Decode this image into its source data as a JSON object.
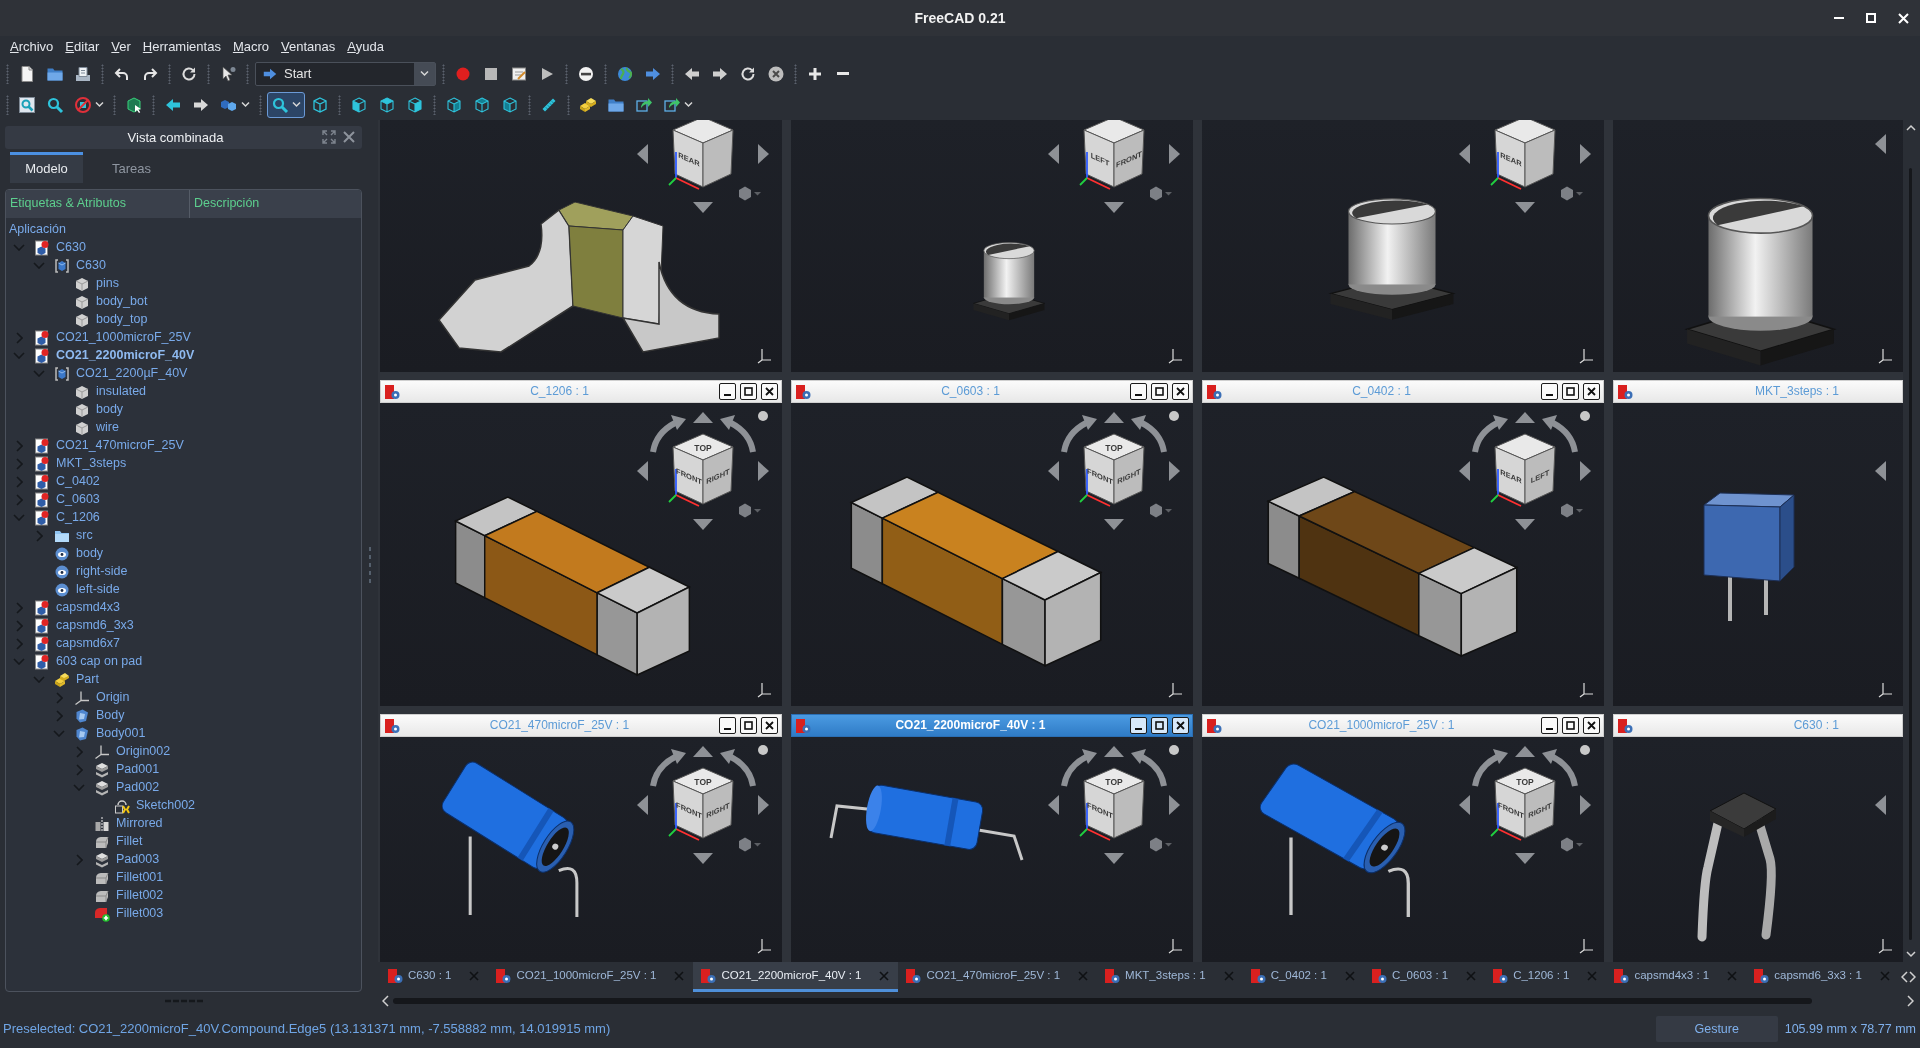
{
  "window": {
    "title": "FreeCAD 0.21"
  },
  "menu": [
    "Archivo",
    "Editar",
    "Ver",
    "Herramientas",
    "Macro",
    "Ventanas",
    "Ayuda"
  ],
  "workbench": {
    "value": "Start"
  },
  "view_toolbar": [
    {
      "pressed": false
    },
    {
      "pressed": false
    },
    {
      "pressed": false
    },
    {
      "pressed": false
    },
    {
      "pressed": false
    },
    {
      "pressed": false
    },
    {
      "pressed": false
    },
    {
      "pressed": true
    },
    {
      "pressed": false
    },
    {
      "pressed": false
    },
    {
      "pressed": false
    },
    {
      "pressed": false
    },
    {
      "pressed": false
    },
    {
      "pressed": false
    },
    {
      "pressed": false
    },
    {
      "pressed": false
    },
    {
      "pressed": false
    },
    {
      "pressed": false
    },
    {
      "pressed": false
    },
    {
      "pressed": false
    }
  ],
  "combo_view": {
    "title": "Vista combinada",
    "tabs": [
      {
        "label": "Modelo",
        "selected": true
      },
      {
        "label": "Tareas",
        "selected": false
      }
    ],
    "columns": [
      "Etiquetas & Atributos",
      "Descripción"
    ],
    "root": "Aplicación",
    "tree": [
      {
        "label": "C630",
        "kind": "document",
        "active": false,
        "expanded": true,
        "children": [
          {
            "label": "C630",
            "kind": "compound",
            "expanded": true,
            "children": [
              {
                "label": "pins",
                "kind": "solid"
              },
              {
                "label": "body_bot",
                "kind": "solid"
              },
              {
                "label": "body_top",
                "kind": "solid"
              }
            ]
          }
        ]
      },
      {
        "label": "CO21_1000microF_25V",
        "kind": "document",
        "active": false,
        "expanded": false
      },
      {
        "label": "CO21_2200microF_40V",
        "kind": "document",
        "active": true,
        "expanded": true,
        "children": [
          {
            "label": "CO21_2200µF_40V",
            "kind": "compound",
            "expanded": true,
            "children": [
              {
                "label": "insulated",
                "kind": "solid"
              },
              {
                "label": "body",
                "kind": "solid"
              },
              {
                "label": "wire",
                "kind": "solid"
              }
            ]
          }
        ]
      },
      {
        "label": "CO21_470microF_25V",
        "kind": "document",
        "active": false,
        "expanded": false
      },
      {
        "label": "MKT_3steps",
        "kind": "document",
        "active": false,
        "expanded": false
      },
      {
        "label": "C_0402",
        "kind": "document",
        "active": false,
        "expanded": false
      },
      {
        "label": "C_0603",
        "kind": "document",
        "active": false,
        "expanded": false
      },
      {
        "label": "C_1206",
        "kind": "document",
        "active": false,
        "expanded": true,
        "children": [
          {
            "label": "src",
            "kind": "folder",
            "expanded": false
          },
          {
            "label": "body",
            "kind": "feature"
          },
          {
            "label": "right-side",
            "kind": "feature"
          },
          {
            "label": "left-side",
            "kind": "feature"
          }
        ]
      },
      {
        "label": "capsmd4x3",
        "kind": "document",
        "active": false,
        "expanded": false
      },
      {
        "label": "capsmd6_3x3",
        "kind": "document",
        "active": false,
        "expanded": false
      },
      {
        "label": "capsmd6x7",
        "kind": "document",
        "active": false,
        "expanded": false
      },
      {
        "label": "603 cap on pad",
        "kind": "document",
        "active": false,
        "expanded": true,
        "children": [
          {
            "label": "Part",
            "kind": "part",
            "expanded": true,
            "children": [
              {
                "label": "Origin",
                "kind": "origin",
                "expanded": false
              },
              {
                "label": "Body",
                "kind": "body",
                "expanded": false
              },
              {
                "label": "Body001",
                "kind": "body",
                "expanded": true,
                "children": [
                  {
                    "label": "Origin002",
                    "kind": "origin",
                    "expanded": false
                  },
                  {
                    "label": "Pad001",
                    "kind": "pad",
                    "expanded": false
                  },
                  {
                    "label": "Pad002",
                    "kind": "pad",
                    "expanded": true,
                    "children": [
                      {
                        "label": "Sketch002",
                        "kind": "sketch"
                      }
                    ]
                  },
                  {
                    "label": "Mirrored",
                    "kind": "mirrored"
                  },
                  {
                    "label": "Fillet",
                    "kind": "fillet"
                  },
                  {
                    "label": "Pad003",
                    "kind": "pad",
                    "expanded": false
                  },
                  {
                    "label": "Fillet001",
                    "kind": "fillet"
                  },
                  {
                    "label": "Fillet002",
                    "kind": "fillet"
                  },
                  {
                    "label": "Fillet003",
                    "kind": "tip"
                  }
                ]
              }
            ]
          }
        ]
      }
    ]
  },
  "viewer": {
    "windows": [
      {
        "kind": "pads-chip",
        "cube_faces": [
          {
            "label": "REAR",
            "kind": "left"
          }
        ]
      },
      {
        "kind": "smd-electrolytic",
        "cube_faces": [
          {
            "label": "LEFT",
            "kind": "left"
          },
          {
            "label": "FRONT",
            "kind": "right"
          }
        ]
      },
      {
        "kind": "smd-electrolytic",
        "cube_faces": [
          {
            "label": "REAR",
            "kind": "left"
          }
        ]
      },
      {
        "kind": "smd-electrolytic"
      },
      {
        "title": "C_1206 : 1",
        "active": false,
        "kind": "chip",
        "color": "#c27a1e",
        "cube_faces": [
          {
            "label": "TOP",
            "kind": "top"
          },
          {
            "label": "FRONT",
            "kind": "left"
          },
          {
            "label": "RIGHT",
            "kind": "right"
          }
        ]
      },
      {
        "title": "C_0603 : 1",
        "active": false,
        "kind": "chip",
        "color": "#c9821f",
        "cube_faces": [
          {
            "label": "TOP",
            "kind": "top"
          },
          {
            "label": "FRONT",
            "kind": "left"
          },
          {
            "label": "RIGHT",
            "kind": "right"
          }
        ]
      },
      {
        "title": "C_0402 : 1",
        "active": false,
        "kind": "chip",
        "color": "#6e4718",
        "cube_faces": [
          {
            "label": "REAR",
            "kind": "left"
          },
          {
            "label": "LEFT",
            "kind": "right"
          }
        ]
      },
      {
        "title": "MKT_3steps : 1",
        "active": false,
        "kind": "box"
      },
      {
        "title": "CO21_470microF_25V : 1",
        "active": false,
        "kind": "axial-tilted",
        "cube_faces": [
          {
            "label": "TOP",
            "kind": "top"
          },
          {
            "label": "FRONT",
            "kind": "left"
          },
          {
            "label": "RIGHT",
            "kind": "right"
          }
        ]
      },
      {
        "title": "CO21_2200microF_40V : 1",
        "active": true,
        "kind": "axial",
        "cube_faces": [
          {
            "label": "TOP",
            "kind": "top"
          },
          {
            "label": "FRONT",
            "kind": "left"
          }
        ]
      },
      {
        "title": "CO21_1000microF_25V : 1",
        "active": false,
        "kind": "axial-tilted",
        "cube_faces": [
          {
            "label": "TOP",
            "kind": "top"
          },
          {
            "label": "FRONT",
            "kind": "left"
          },
          {
            "label": "RIGHT",
            "kind": "right"
          }
        ]
      },
      {
        "title": "C630 : 1",
        "active": false,
        "kind": "bent-leads"
      }
    ]
  },
  "document_tabs": [
    {
      "label": "C630 : 1",
      "selected": false
    },
    {
      "label": "CO21_1000microF_25V : 1",
      "selected": false
    },
    {
      "label": "CO21_2200microF_40V : 1",
      "selected": true
    },
    {
      "label": "CO21_470microF_25V : 1",
      "selected": false
    },
    {
      "label": "MKT_3steps : 1",
      "selected": false
    },
    {
      "label": "C_0402 : 1",
      "selected": false
    },
    {
      "label": "C_0603 : 1",
      "selected": false
    },
    {
      "label": "C_1206 : 1",
      "selected": false
    },
    {
      "label": "capsmd4x3 : 1",
      "selected": false
    },
    {
      "label": "capsmd6_3x3 : 1",
      "selected": false
    }
  ],
  "status_bar": {
    "message": "Preselected: CO21_2200microF_40V.Compound.Edge5 (13.131371 mm, -7.558882 mm, 14.019915 mm)",
    "navigation": "Gesture",
    "dimensions": "105.99 mm x 78.77 mm"
  }
}
